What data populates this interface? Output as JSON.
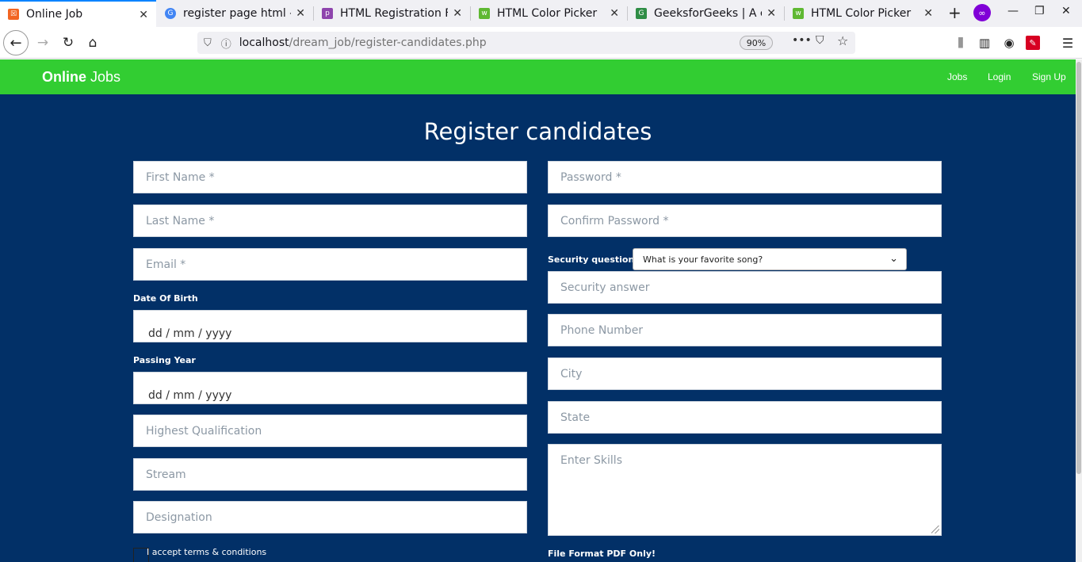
{
  "browser": {
    "tabs": [
      {
        "title": "Online Job",
        "active": true,
        "favicon_color": "#f26522",
        "favicon_glyph": "☒"
      },
      {
        "title": "register page html - G",
        "active": false,
        "favicon_color": "#4285f4",
        "favicon_glyph": "G"
      },
      {
        "title": "HTML Registration F",
        "active": false,
        "favicon_color": "#8e44ad",
        "favicon_glyph": "p"
      },
      {
        "title": "HTML Color Picker",
        "active": false,
        "favicon_color": "#5fb832",
        "favicon_glyph": "w"
      },
      {
        "title": "GeeksforGeeks | A c",
        "active": false,
        "favicon_color": "#2f8d46",
        "favicon_glyph": "G"
      },
      {
        "title": "HTML Color Picker",
        "active": false,
        "favicon_color": "#5fb832",
        "favicon_glyph": "w"
      }
    ],
    "url_host": "localhost",
    "url_path": "/dream_job/register-candidates.php",
    "zoom": "90%"
  },
  "site": {
    "brand_bold": "Online",
    "brand_rest": " Jobs",
    "nav": [
      "Jobs",
      "Login",
      "Sign Up"
    ],
    "header_color": "#32cd32",
    "page_bg": "#023067"
  },
  "form": {
    "title": "Register candidates",
    "first_name": "First Name *",
    "last_name": "Last Name *",
    "email": "Email *",
    "dob_label": "Date Of Birth",
    "dob_value": "dd / mm / yyyy",
    "passing_label": "Passing Year",
    "passing_value": "dd / mm / yyyy",
    "qualification": "Highest Qualification",
    "stream": "Stream",
    "designation": "Designation",
    "terms": "I accept terms & conditions",
    "password": "Password *",
    "confirm_password": "Confirm Password *",
    "security_label": "Security question :",
    "security_selected": "What is your favorite song?",
    "security_answer": "Security answer",
    "phone": "Phone Number",
    "city": "City",
    "state": "State",
    "skills": "Enter Skills",
    "file_label": "File Format PDF Only!"
  }
}
